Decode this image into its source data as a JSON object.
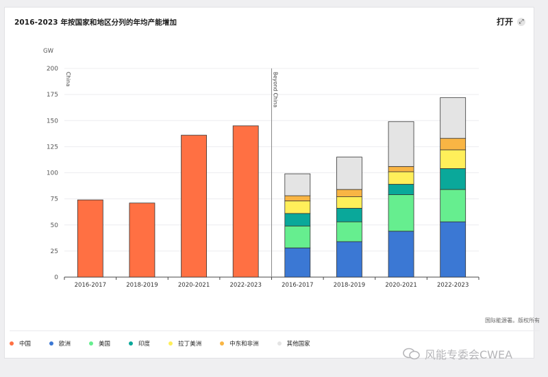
{
  "title": "2016-2023 年按国家和地区分列的年均产能增加",
  "open_label": "打开",
  "source": "国际能源署。版权所有",
  "watermark": "风能专委会CWEA",
  "chart_data": {
    "type": "bar",
    "title": "2016-2023 年按国家和地区分列的年均产能增加",
    "ylabel": "GW",
    "ylim": [
      0,
      200
    ],
    "yticks": [
      0,
      25,
      50,
      75,
      100,
      125,
      150,
      175,
      200
    ],
    "grid": true,
    "panels": [
      "China",
      "Beyond China"
    ],
    "categories": [
      "2016-2017",
      "2018-2019",
      "2020-2021",
      "2022-2023"
    ],
    "china": {
      "name": "中国",
      "color": "#ff7043",
      "values": [
        74,
        71,
        136,
        145
      ]
    },
    "beyond_china": {
      "series": [
        {
          "name": "欧洲",
          "color": "#3b78d4",
          "values": [
            28,
            34,
            44,
            53
          ]
        },
        {
          "name": "美国",
          "color": "#66ee8f",
          "values": [
            21,
            19,
            35,
            31
          ]
        },
        {
          "name": "印度",
          "color": "#0aa89a",
          "values": [
            12,
            13,
            10,
            20
          ]
        },
        {
          "name": "拉丁美洲",
          "color": "#ffef5a",
          "values": [
            12,
            11,
            12,
            18
          ]
        },
        {
          "name": "中东和非洲",
          "color": "#f9b544",
          "values": [
            5,
            7,
            5,
            11
          ]
        },
        {
          "name": "其他国家",
          "color": "#e4e4e4",
          "values": [
            21,
            31,
            43,
            39
          ]
        }
      ]
    },
    "legend": [
      {
        "name": "中国",
        "color": "#ff7043"
      },
      {
        "name": "欧洲",
        "color": "#3b78d4"
      },
      {
        "name": "美国",
        "color": "#66ee8f"
      },
      {
        "name": "印度",
        "color": "#0aa89a"
      },
      {
        "name": "拉丁美洲",
        "color": "#ffef5a"
      },
      {
        "name": "中东和非洲",
        "color": "#f9b544"
      },
      {
        "name": "其他国家",
        "color": "#e4e4e4"
      }
    ],
    "legend_position": "bottom"
  }
}
